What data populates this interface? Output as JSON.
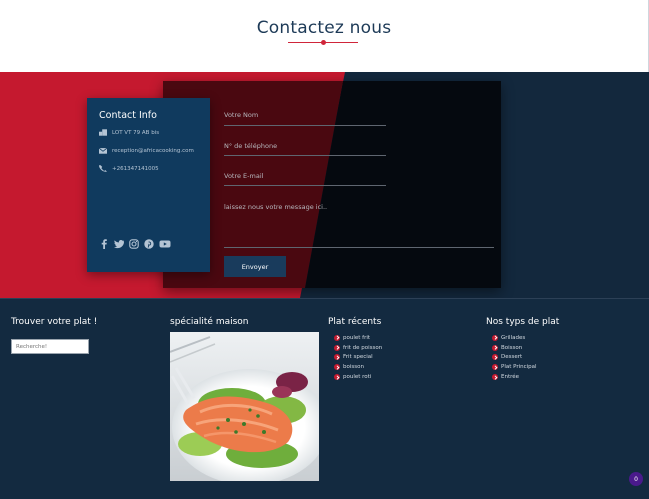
{
  "header": {
    "title": "Contactez nous"
  },
  "contact_info": {
    "title": "Contact Info",
    "address": "LOT VT 79 AB bis",
    "email": "reception@africacooking.com",
    "phone": "+261347141005",
    "socials": [
      "facebook-icon",
      "twitter-icon",
      "instagram-icon",
      "pinterest-icon",
      "youtube-icon"
    ]
  },
  "form": {
    "name_placeholder": "Votre Nom",
    "phone_placeholder": "N° de téléphone",
    "email_placeholder": "Votre E-mail",
    "message_placeholder": "laissez nous votre message ici..",
    "send_label": "Envoyer"
  },
  "footer": {
    "search": {
      "title": "Trouver votre plat !",
      "placeholder": "Recherche!"
    },
    "specialty": {
      "title": "spécialité maison"
    },
    "recent": {
      "title": "Plat récents",
      "items": [
        "poulet frit",
        "frit de poisson",
        "Frit special",
        "boisson",
        "poulet roti"
      ]
    },
    "types": {
      "title": "Nos typs de plat",
      "items": [
        "Grillades",
        "Boisson",
        "Dessert",
        "Plat Principal",
        "Entrée"
      ]
    }
  },
  "badge": {
    "count": "0"
  },
  "colors": {
    "accent_red": "#c5192f",
    "navy": "#13283d",
    "card_blue": "#103a5e"
  }
}
